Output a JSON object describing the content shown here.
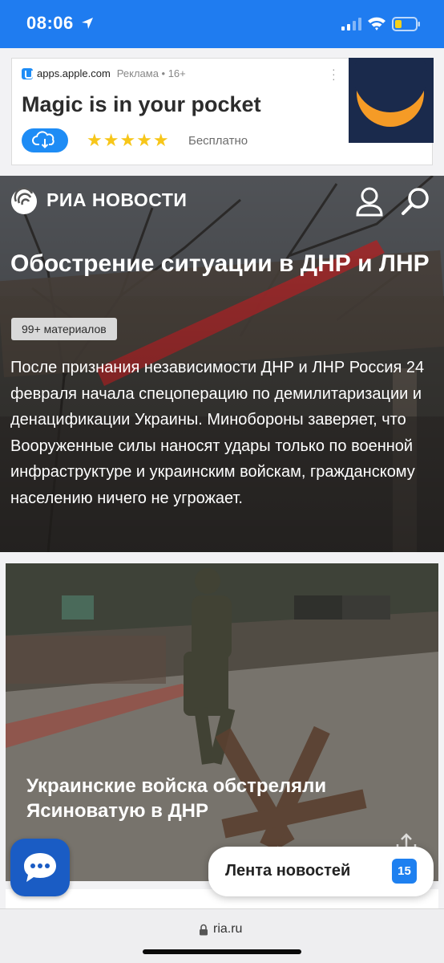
{
  "status_bar": {
    "time": "08:06",
    "location_icon": "location-arrow-icon",
    "signal_icon": "cellular-signal-icon",
    "wifi_icon": "wifi-icon",
    "battery_icon": "battery-low-icon",
    "battery_color": "#f5d11b"
  },
  "ad": {
    "source": "apps.apple.com",
    "meta": "Реклама • 16+",
    "headline": "Magic is in your pocket",
    "download_icon": "cloud-download-icon",
    "stars": "★★★★★",
    "rating": 5,
    "price_label": "Бесплатно",
    "thumbnail": "moon-app-icon"
  },
  "header": {
    "logo_text": "РИА НОВОСТИ",
    "user_icon": "user-icon",
    "search_icon": "search-icon"
  },
  "hero": {
    "title": "Обострение ситуации в ДНР и ЛНР",
    "badge": "99+ материалов",
    "description": "После признания независимости ДНР и ЛНР Россия 24 февраля начала спецоперацию по демилитаризации и денацификации Украины. Минобороны заверяет, что Вооруженные силы наносят удары только по военной инфраструктуре и украинским войскам, гражданскому населению ничего не угрожает."
  },
  "news_card": {
    "headline": "Украинские войска обстреляли Ясиноватую в ДНР",
    "share_icon": "share-icon"
  },
  "floating": {
    "chat_icon": "chat-bubble-icon",
    "feed_label": "Лента новостей",
    "feed_count": "15"
  },
  "browser": {
    "lock_icon": "lock-icon",
    "url": "ria.ru"
  },
  "colors": {
    "accent": "#1f7cf0",
    "chat_button": "#1a5cc4",
    "star": "#f7c619"
  }
}
